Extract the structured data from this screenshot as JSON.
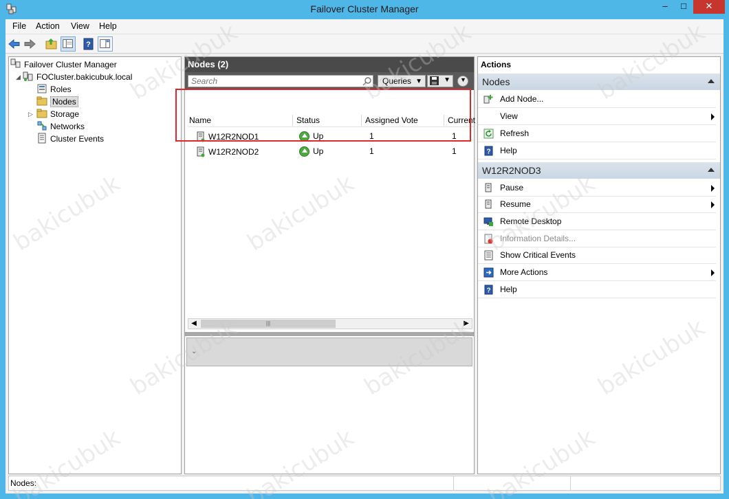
{
  "window": {
    "title": "Failover Cluster Manager",
    "minimize": "–",
    "maximize": "□",
    "close": "✕"
  },
  "menu": [
    "File",
    "Action",
    "View",
    "Help"
  ],
  "tree": {
    "root": "Failover Cluster Manager",
    "cluster": "FOCluster.bakicubuk.local",
    "items": [
      "Roles",
      "Nodes",
      "Storage",
      "Networks",
      "Cluster Events"
    ],
    "selected": "Nodes"
  },
  "center": {
    "title": "Nodes (2)",
    "search_placeholder": "Search",
    "queries_label": "Queries",
    "columns": [
      "Name",
      "Status",
      "Assigned Vote",
      "Current"
    ],
    "rows": [
      {
        "name": "W12R2NOD1",
        "status": "Up",
        "assigned_vote": "1",
        "current": "1"
      },
      {
        "name": "W12R2NOD2",
        "status": "Up",
        "assigned_vote": "1",
        "current": "1"
      }
    ]
  },
  "actions": {
    "title": "Actions",
    "sections": [
      {
        "header": "Nodes",
        "items": [
          {
            "label": "Add Node...",
            "icon": "add-node-icon",
            "submenu": false,
            "enabled": true
          },
          {
            "label": "View",
            "icon": "",
            "submenu": true,
            "enabled": true
          },
          {
            "label": "Refresh",
            "icon": "refresh-icon",
            "submenu": false,
            "enabled": true
          },
          {
            "label": "Help",
            "icon": "help-icon",
            "submenu": false,
            "enabled": true
          }
        ]
      },
      {
        "header": "W12R2NOD3",
        "items": [
          {
            "label": "Pause",
            "icon": "pause-node-icon",
            "submenu": true,
            "enabled": true
          },
          {
            "label": "Resume",
            "icon": "resume-node-icon",
            "submenu": true,
            "enabled": true
          },
          {
            "label": "Remote Desktop",
            "icon": "remote-desktop-icon",
            "submenu": false,
            "enabled": true
          },
          {
            "label": "Information Details...",
            "icon": "information-details-icon",
            "submenu": false,
            "enabled": false
          },
          {
            "label": "Show Critical Events",
            "icon": "critical-events-icon",
            "submenu": false,
            "enabled": true
          },
          {
            "label": "More Actions",
            "icon": "more-actions-icon",
            "submenu": true,
            "enabled": true
          },
          {
            "label": "Help",
            "icon": "help-icon",
            "submenu": false,
            "enabled": true
          }
        ]
      }
    ]
  },
  "statusbar": {
    "text": "Nodes:"
  },
  "watermark": "bakicubuk",
  "colors": {
    "frame": "#4fb6e8",
    "highlight": "#e3262b",
    "section_header": "#c9d6e3",
    "up_status": "#4caa3e"
  }
}
